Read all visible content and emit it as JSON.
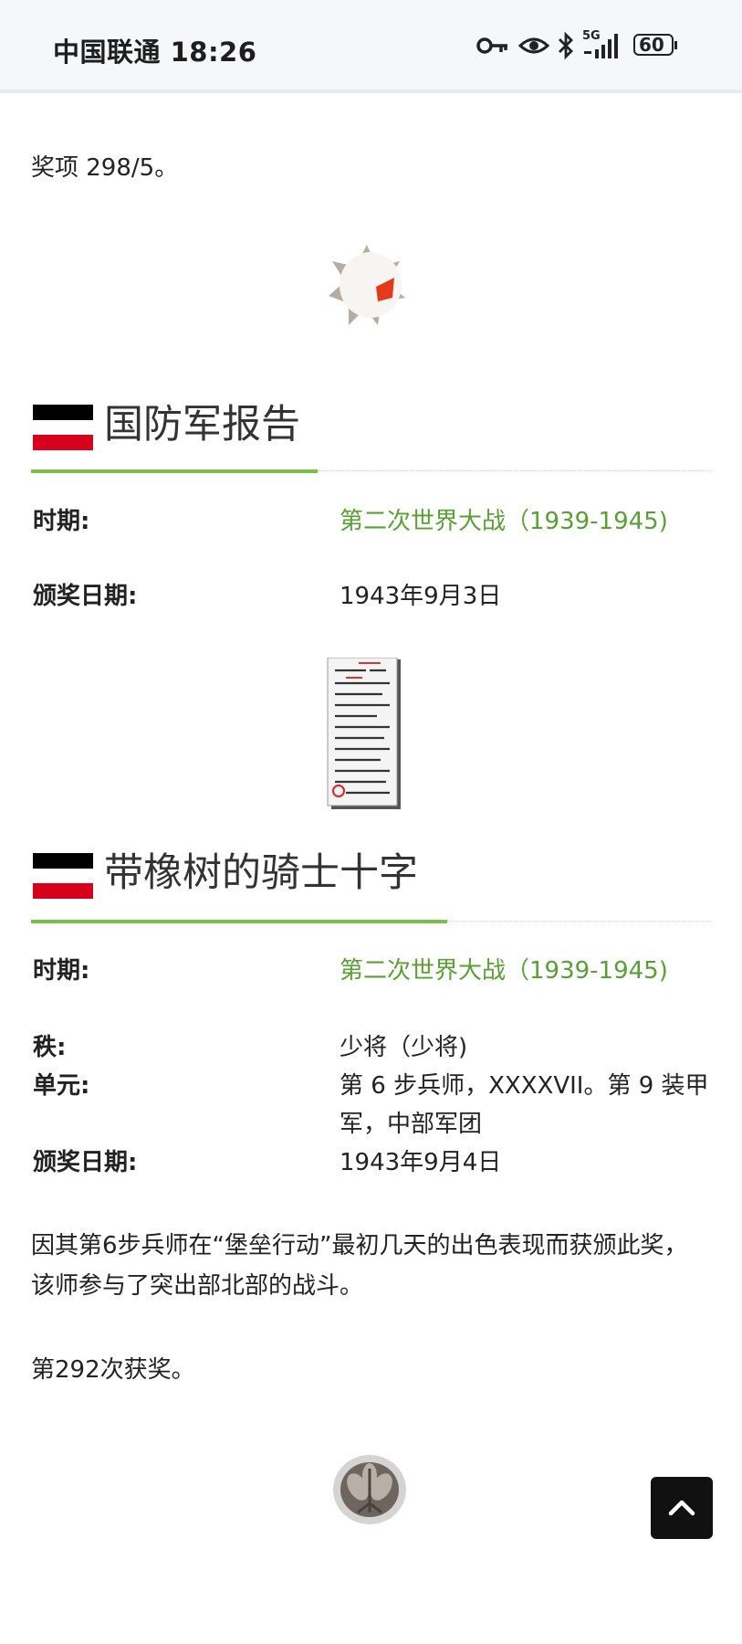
{
  "status_bar": {
    "carrier_time": "中国联通 18:26",
    "network": "5G",
    "battery": "60",
    "icons": [
      "key-icon",
      "eye-icon",
      "bluetooth-icon",
      "signal-icon",
      "battery-icon"
    ]
  },
  "intro": {
    "text": "奖项 298/5。"
  },
  "section1": {
    "title": "国防军报告",
    "rows": [
      {
        "label": "时期:",
        "value": "第二次世界大战（1939-1945)",
        "link": true
      },
      {
        "label": "颁奖日期:",
        "value": "1943年9月3日",
        "link": false
      }
    ]
  },
  "section2": {
    "title": "带橡树的骑士十字",
    "rows": [
      {
        "label": "时期:",
        "value": "第二次世界大战（1939-1945)",
        "link": true
      },
      {
        "label": "秩:",
        "value": "少将（少将)",
        "link": false
      },
      {
        "label": "单元:",
        "value": "第 6 步兵师，XXXXVII。第 9 装甲军，中部军团",
        "link": false
      },
      {
        "label": "颁奖日期:",
        "value": "1943年9月4日",
        "link": false
      }
    ],
    "description": "因其第6步兵师在“堡垒行动”最初几天的出色表现而获颁此奖，该师参与了突出部北部的战斗。",
    "count": "第292次获奖。"
  },
  "colors": {
    "accent_green": "#7bbf4a",
    "link_green": "#5a9e36",
    "flag_black": "#000000",
    "flag_red": "#d7001c"
  }
}
